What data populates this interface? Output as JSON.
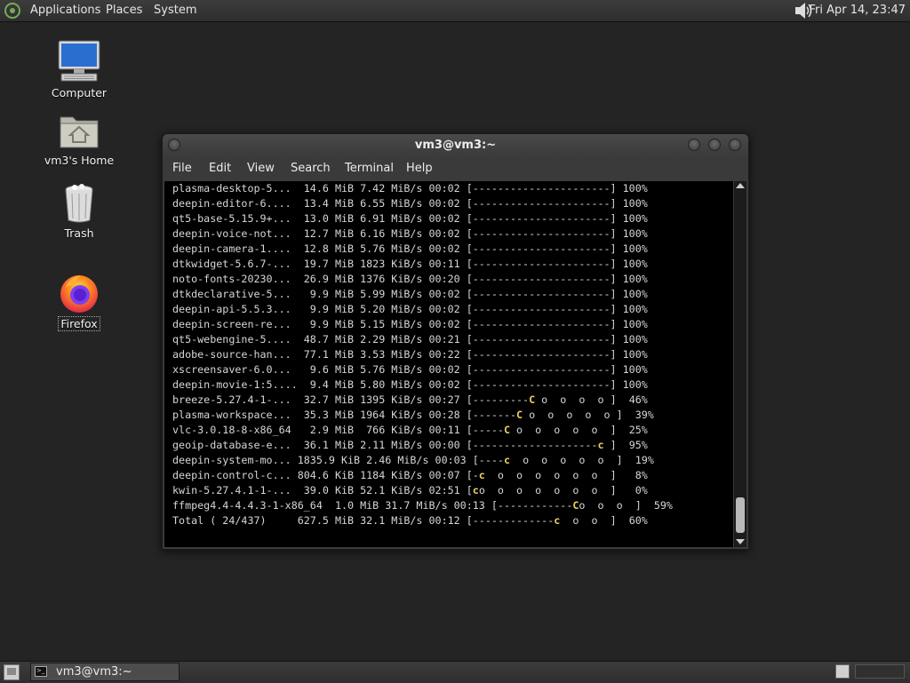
{
  "top_panel": {
    "menus": [
      "Applications",
      "Places",
      "System"
    ],
    "clock": "Fri Apr 14, 23:47"
  },
  "desktop_icons": [
    {
      "label": "Computer",
      "icon": "computer-icon"
    },
    {
      "label": "vm3's Home",
      "icon": "home-folder-icon"
    },
    {
      "label": "Trash",
      "icon": "trash-icon"
    },
    {
      "label": "Firefox",
      "icon": "firefox-icon"
    }
  ],
  "terminal": {
    "title": "vm3@vm3:~",
    "menu": [
      "File",
      "Edit",
      "View",
      "Search",
      "Terminal",
      "Help"
    ],
    "rows": [
      {
        "name": "plasma-desktop-5...",
        "size": "14.6 MiB",
        "rate": "7.42 MiB/s",
        "eta": "00:02",
        "bar": "[----------------------]",
        "pct": "100%"
      },
      {
        "name": "deepin-editor-6....",
        "size": "13.4 MiB",
        "rate": "6.55 MiB/s",
        "eta": "00:02",
        "bar": "[----------------------]",
        "pct": "100%"
      },
      {
        "name": "qt5-base-5.15.9+...",
        "size": "13.0 MiB",
        "rate": "6.91 MiB/s",
        "eta": "00:02",
        "bar": "[----------------------]",
        "pct": "100%"
      },
      {
        "name": "deepin-voice-not...",
        "size": "12.7 MiB",
        "rate": "6.16 MiB/s",
        "eta": "00:02",
        "bar": "[----------------------]",
        "pct": "100%"
      },
      {
        "name": "deepin-camera-1....",
        "size": "12.8 MiB",
        "rate": "5.76 MiB/s",
        "eta": "00:02",
        "bar": "[----------------------]",
        "pct": "100%"
      },
      {
        "name": "dtkwidget-5.6.7-...",
        "size": "19.7 MiB",
        "rate": "1823 KiB/s",
        "eta": "00:11",
        "bar": "[----------------------]",
        "pct": "100%"
      },
      {
        "name": "noto-fonts-20230...",
        "size": "26.9 MiB",
        "rate": "1376 KiB/s",
        "eta": "00:20",
        "bar": "[----------------------]",
        "pct": "100%"
      },
      {
        "name": "dtkdeclarative-5...",
        "size": "9.9 MiB",
        "rate": "5.99 MiB/s",
        "eta": "00:02",
        "bar": "[----------------------]",
        "pct": "100%"
      },
      {
        "name": "deepin-api-5.5.3...",
        "size": "9.9 MiB",
        "rate": "5.20 MiB/s",
        "eta": "00:02",
        "bar": "[----------------------]",
        "pct": "100%"
      },
      {
        "name": "deepin-screen-re...",
        "size": "9.9 MiB",
        "rate": "5.15 MiB/s",
        "eta": "00:02",
        "bar": "[----------------------]",
        "pct": "100%"
      },
      {
        "name": "qt5-webengine-5....",
        "size": "48.7 MiB",
        "rate": "2.29 MiB/s",
        "eta": "00:21",
        "bar": "[----------------------]",
        "pct": "100%"
      },
      {
        "name": "adobe-source-han...",
        "size": "77.1 MiB",
        "rate": "3.53 MiB/s",
        "eta": "00:22",
        "bar": "[----------------------]",
        "pct": "100%"
      },
      {
        "name": "xscreensaver-6.0...",
        "size": "9.6 MiB",
        "rate": "5.76 MiB/s",
        "eta": "00:02",
        "bar": "[----------------------]",
        "pct": "100%"
      },
      {
        "name": "deepin-movie-1:5....",
        "size": "9.4 MiB",
        "rate": "5.80 MiB/s",
        "eta": "00:02",
        "bar": "[----------------------]",
        "pct": "100%"
      },
      {
        "name": "breeze-5.27.4-1-...",
        "size": "32.7 MiB",
        "rate": "1395 KiB/s",
        "eta": "00:27",
        "bar": "[---------C o  o  o  o ]",
        "pct": "46%"
      },
      {
        "name": "plasma-workspace...",
        "size": "35.3 MiB",
        "rate": "1964 KiB/s",
        "eta": "00:28",
        "bar": "[-------C o  o  o  o  o ]",
        "pct": "39%"
      },
      {
        "name": "vlc-3.0.18-8-x86_64",
        "size": "2.9 MiB",
        "rate": "766 KiB/s",
        "eta": "00:11",
        "bar": "[-----C o  o  o  o  o  ]",
        "pct": "25%"
      },
      {
        "name": "geoip-database-e...",
        "size": "36.1 MiB",
        "rate": "2.11 MiB/s",
        "eta": "00:00",
        "bar": "[--------------------c ]",
        "pct": "95%"
      },
      {
        "name": "deepin-system-mo...",
        "size": "1835.9 KiB",
        "rate": "2.46 MiB/s",
        "eta": "00:03",
        "bar": "[----c  o  o  o  o  o  ]",
        "pct": "19%"
      },
      {
        "name": "deepin-control-c...",
        "size": "804.6 KiB",
        "rate": "1184 KiB/s",
        "eta": "00:07",
        "bar": "[-c  o  o  o  o  o  o  ]",
        "pct": "8%"
      },
      {
        "name": "kwin-5.27.4.1-1-...",
        "size": "39.0 KiB",
        "rate": "52.1 KiB/s",
        "eta": "02:51",
        "bar": "[co  o  o  o  o  o  o  ]",
        "pct": "0%"
      },
      {
        "name": "ffmpeg4.4-4.4.3-1-x86_64",
        "size": "1.0 MiB",
        "rate": "31.7 MiB/s",
        "eta": "00:13",
        "bar": "[------------Co  o  o  ]",
        "pct": "59%"
      },
      {
        "name": "Total ( 24/437)",
        "size": "627.5 MiB",
        "rate": "32.1 MiB/s",
        "eta": "00:12",
        "bar": "[-------------c  o  o  ]",
        "pct": "60%"
      }
    ]
  },
  "taskbar": {
    "task_label": "vm3@vm3:~"
  },
  "colors": {
    "desktop": "#232423",
    "terminal_bg": "#000000",
    "terminal_fg": "#d6d6d6",
    "pacman": "#e8d060"
  }
}
